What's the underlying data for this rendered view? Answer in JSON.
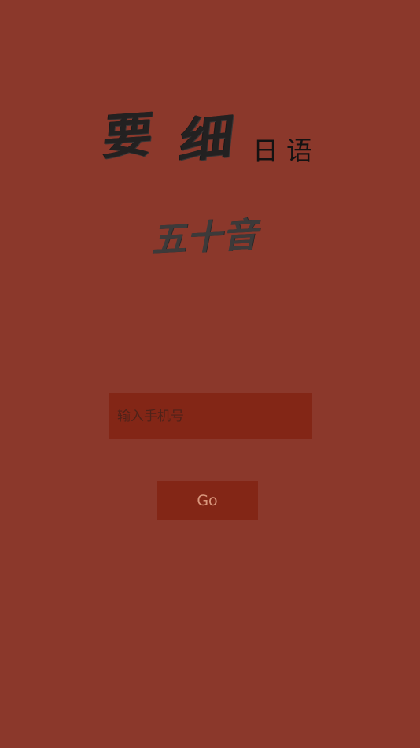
{
  "logo": {
    "brush_char_1": "要",
    "brush_char_2": "细",
    "suffix": "日语"
  },
  "subtitle": "五十音",
  "login": {
    "phone_placeholder": "输入手机号",
    "phone_value": "",
    "go_label": "Go"
  },
  "colors": {
    "background": "#8b382b",
    "input_background": "#832616",
    "button_background": "#832616",
    "button_text": "#d9977d",
    "logo_text": "#232121"
  }
}
